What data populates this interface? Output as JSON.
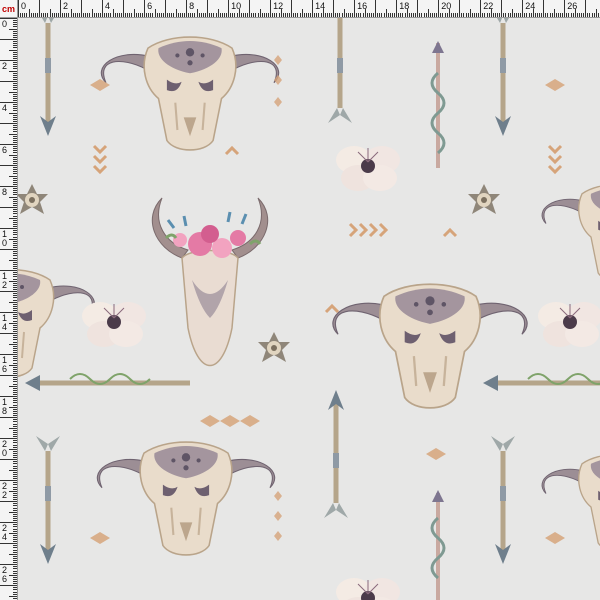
{
  "ruler": {
    "unit": "cm",
    "top_labels": [
      "0",
      "2",
      "4",
      "6",
      "8",
      "10",
      "12",
      "14",
      "16",
      "18",
      "20",
      "22",
      "24",
      "26"
    ],
    "left_labels": [
      "0",
      "2",
      "4",
      "6",
      "8",
      "10",
      "12",
      "14",
      "16",
      "18",
      "20",
      "22",
      "24",
      "26"
    ]
  },
  "fabric": {
    "background": "#e7e7e6",
    "motifs": [
      "bull-skull",
      "floral-crown-skull",
      "arrow",
      "feather-arrow",
      "snake-arrow",
      "flower",
      "diamond",
      "chevron",
      "star-ornament"
    ],
    "colors": {
      "bone": "#e9dccb",
      "bone_shadow": "#b9a48a",
      "horn": "#8c7b86",
      "tribal": "#5f5566",
      "arrow_shaft": "#b5a58a",
      "arrow_head": "#6f7f8c",
      "rose": "#e47aa5",
      "diamond": "#d6a47a",
      "leaf": "#7fa36a"
    }
  }
}
